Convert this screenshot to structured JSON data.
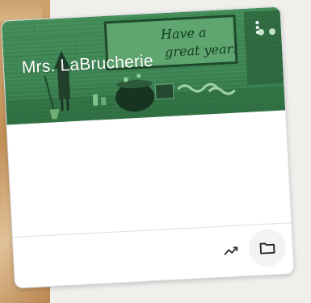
{
  "card": {
    "title": "Mrs. LaBrucherie",
    "banner_sign_text": "Have a great year!",
    "banner_color": "#3f8a55"
  },
  "icons": {
    "menu": "more-vert-icon",
    "grades": "trending-up-icon",
    "folder": "folder-icon"
  }
}
